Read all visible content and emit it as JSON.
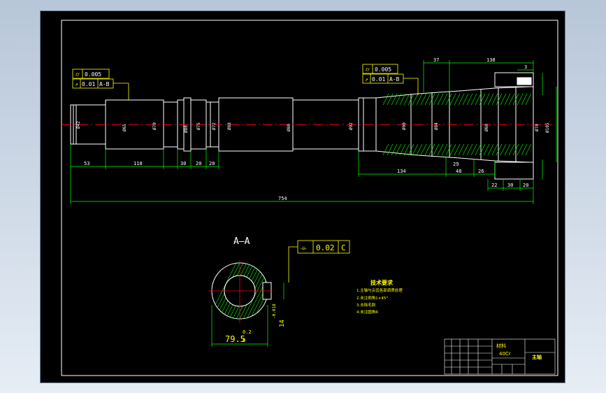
{
  "view": {
    "label_section": "A—A",
    "colors": {
      "background": "#000000",
      "frame": "#ffffff",
      "outline": "#ffffff",
      "dimension": "#00ff00",
      "annotation": "#ffff00",
      "centerline": "#ff0000",
      "hatch": "#00ff00",
      "viewport": "#d9e3ee"
    }
  },
  "dimensions": {
    "left_segments": [
      "53",
      "118",
      "30",
      "20",
      "20"
    ],
    "right_segments": [
      "134",
      "29",
      "48",
      "26"
    ],
    "right_bottom": [
      "22",
      "30",
      "20"
    ],
    "top": [
      "37",
      "138",
      "3"
    ],
    "overall": "754"
  },
  "tolerances": {
    "left": {
      "cylindricity": "0.005",
      "runout": "0.01",
      "datum": "A-B"
    },
    "right": {
      "cylindricity": "0.005",
      "runout": "0.01",
      "datum": "A-B"
    },
    "section": {
      "flatness": "0.02",
      "datum": "C"
    }
  },
  "section": {
    "diameter": "79.5",
    "tol_upper": "0.2",
    "tol_lower": "0",
    "keyway_width": "14",
    "keyway_tol": "-0.018"
  },
  "notes": {
    "title": "技术要求",
    "items": [
      "1.主轴与尖齿各部调质处理",
      "2.未注倒角1×45°",
      "3.去除毛刺",
      "4.未注圆角R"
    ]
  },
  "title_block": {
    "material_label": "材料",
    "material": "40Cr",
    "part_name": "主轴"
  }
}
